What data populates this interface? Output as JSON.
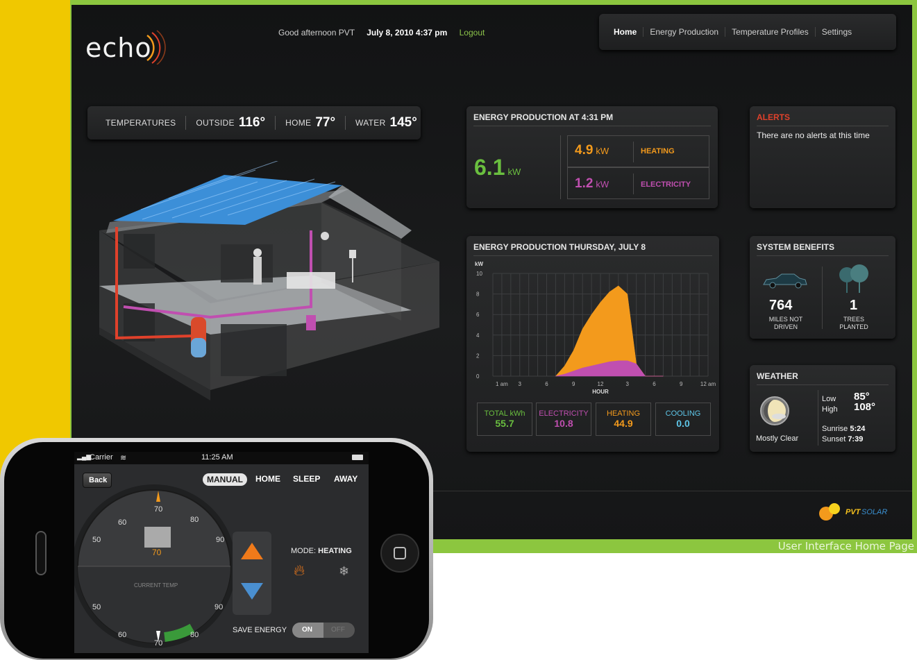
{
  "header": {
    "logo_text": "echo",
    "greeting": "Good afternoon PVT",
    "datetime": "July 8, 2010 4:37 pm",
    "logout": "Logout",
    "nav": [
      "Home",
      "Energy Production",
      "Temperature Profiles",
      "Settings"
    ]
  },
  "temperatures": {
    "label": "TEMPERATURES",
    "outside_label": "OUTSIDE",
    "outside_value": "116°",
    "home_label": "HOME",
    "home_value": "77°",
    "water_label": "WATER",
    "water_value": "145°"
  },
  "energy_now": {
    "title": "ENERGY PRODUCTION AT 4:31 PM",
    "total_value": "6.1",
    "total_unit": "kW",
    "heating_value": "4.9",
    "heating_unit": "kW",
    "heating_label": "HEATING",
    "electricity_value": "1.2",
    "electricity_unit": "kW",
    "electricity_label": "ELECTRICITY"
  },
  "alerts": {
    "title": "ALERTS",
    "message": "There are no alerts at this time"
  },
  "energy_chart": {
    "title": "ENERGY PRODUCTION THURSDAY, JULY 8",
    "y_unit": "kW",
    "x_title": "HOUR",
    "totals": [
      {
        "label": "TOTAL kWh",
        "value": "55.7",
        "color": "#6abf3f"
      },
      {
        "label": "ELECTRICITY",
        "value": "10.8",
        "color": "#c04fb0"
      },
      {
        "label": "HEATING",
        "value": "44.9",
        "color": "#f39a1c"
      },
      {
        "label": "COOLING",
        "value": "0.0",
        "color": "#5ec6e8"
      }
    ]
  },
  "chart_data": {
    "type": "area",
    "title": "ENERGY PRODUCTION THURSDAY, JULY 8",
    "xlabel": "HOUR",
    "ylabel": "kW",
    "x_tick_labels": [
      "1 am",
      "3",
      "6",
      "9",
      "12",
      "3",
      "6",
      "9",
      "12 am"
    ],
    "x_tick_hours": [
      1,
      3,
      6,
      9,
      12,
      15,
      18,
      21,
      24
    ],
    "y_ticks": [
      0,
      2,
      4,
      6,
      8,
      10
    ],
    "xlim": [
      0,
      24
    ],
    "ylim": [
      0,
      10
    ],
    "grid": true,
    "x": [
      7,
      8,
      9,
      10,
      11,
      12,
      13,
      14,
      15,
      16,
      17,
      18,
      19
    ],
    "series": [
      {
        "name": "ELECTRICITY",
        "color": "#c04fb0",
        "values": [
          0,
          0.2,
          0.5,
          0.8,
          1.0,
          1.2,
          1.4,
          1.5,
          1.5,
          1.2,
          0,
          0,
          0
        ]
      },
      {
        "name": "HEATING",
        "color": "#f39a1c",
        "values": [
          0,
          0.8,
          2.0,
          3.8,
          5.0,
          6.0,
          6.8,
          7.3,
          6.5,
          0,
          0,
          0,
          0
        ]
      }
    ]
  },
  "benefits": {
    "title": "SYSTEM BENEFITS",
    "miles_value": "764",
    "miles_label_1": "MILES NOT",
    "miles_label_2": "DRIVEN",
    "trees_value": "1",
    "trees_label_1": "TREES",
    "trees_label_2": "PLANTED"
  },
  "weather": {
    "title": "WEATHER",
    "condition": "Mostly Clear",
    "low_label": "Low",
    "low_value": "85°",
    "high_label": "High",
    "high_value": "108°",
    "sunrise_label": "Sunrise",
    "sunrise_value": "5:24",
    "sunset_label": "Sunset",
    "sunset_value": "7:39"
  },
  "brand": {
    "logo_text_1": "PVT",
    "logo_text_2": "SOLAR"
  },
  "caption": "User Interface Home Page",
  "phone": {
    "carrier": "Carrier",
    "time": "11:25 AM",
    "back": "Back",
    "modes": [
      "MANUAL",
      "HOME",
      "SLEEP",
      "AWAY"
    ],
    "dial_top_labels": [
      "60",
      "70",
      "80",
      "90",
      "50"
    ],
    "dial_bottom_labels": [
      "50",
      "90",
      "60",
      "70",
      "80"
    ],
    "set_temp": "70",
    "current_temp_label": "CURRENT TEMP",
    "mode_label": "MODE:",
    "mode_value": "HEATING",
    "save_energy_label": "SAVE ENERGY",
    "toggle_on": "ON",
    "toggle_off": "OFF"
  },
  "colors": {
    "green": "#6abf3f",
    "orange": "#f39a1c",
    "magenta": "#c04fb0",
    "cyan": "#5ec6e8",
    "alert_red": "#e0412b"
  }
}
